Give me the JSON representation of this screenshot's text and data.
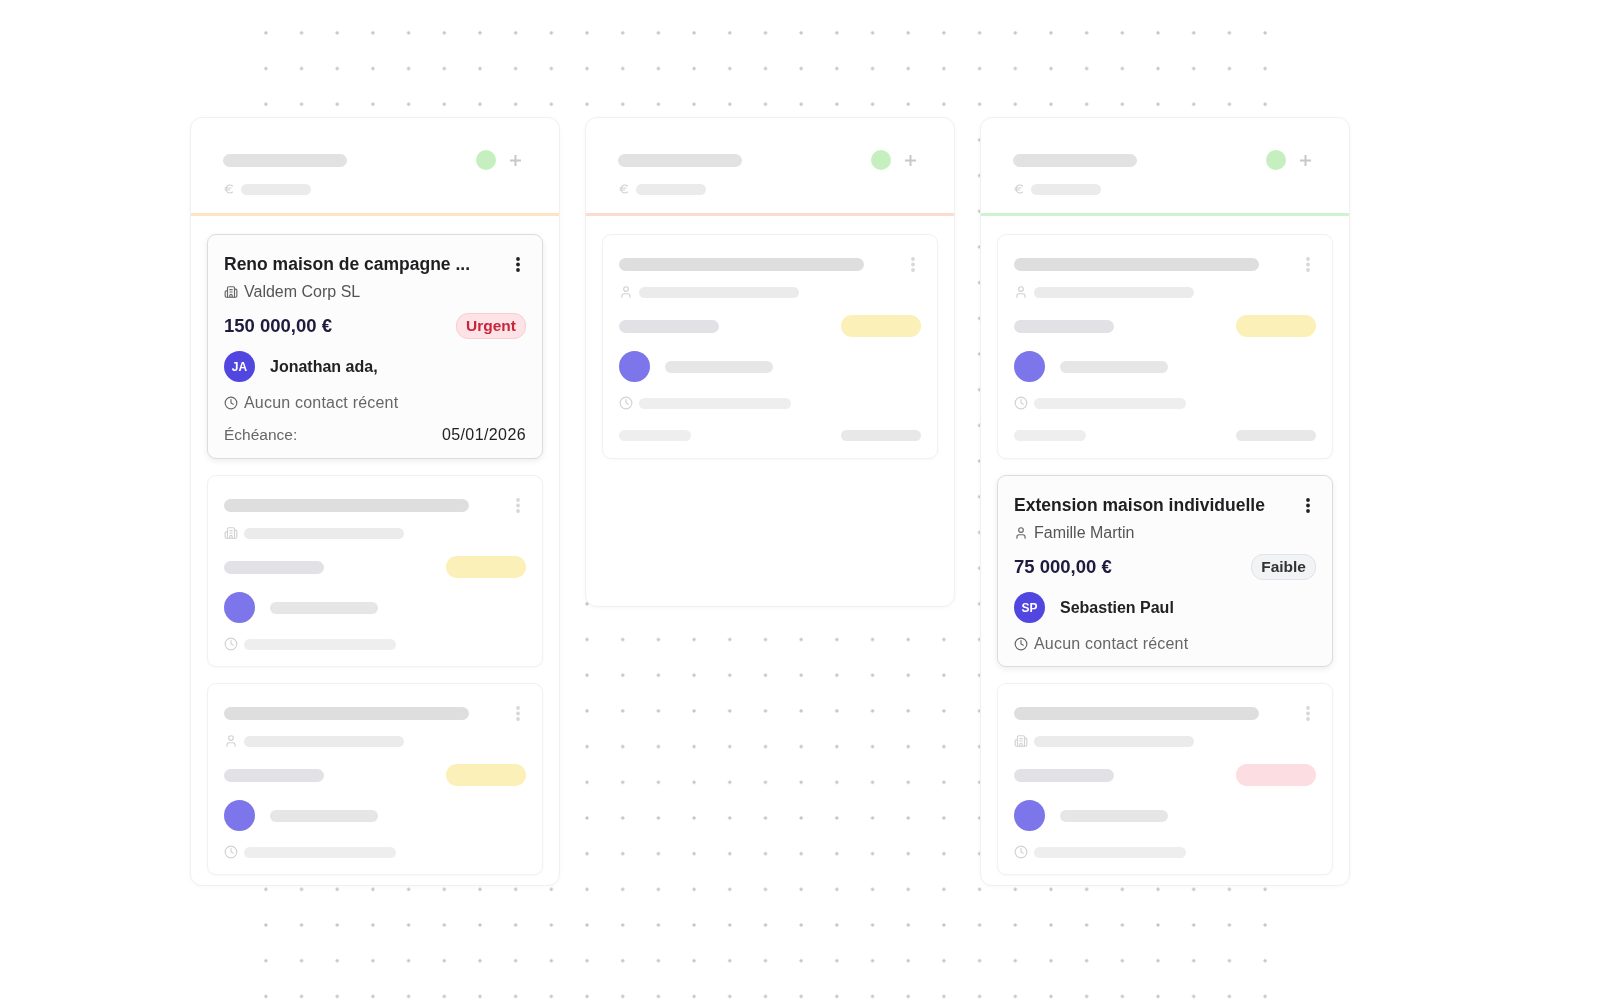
{
  "columns": [
    {
      "color": "#fde4c4",
      "cards": [
        {
          "blurred": false,
          "title": "Reno maison de campagne ...",
          "client": {
            "kind": "company",
            "name": "Valdem Corp SL"
          },
          "amount": "150 000,00 €",
          "priority": {
            "kind": "urgent",
            "label": "Urgent"
          },
          "assignee": {
            "initials": "JA",
            "name": "Jonathan ada,"
          },
          "last_contact": "Aucun contact récent",
          "due": {
            "label": "Échéance:",
            "date": "05/01/2026"
          }
        },
        {
          "blurred": true,
          "client": {
            "kind": "company"
          },
          "priority": {
            "kind": "medium"
          },
          "has_due": false
        },
        {
          "blurred": true,
          "client": {
            "kind": "person"
          },
          "priority": {
            "kind": "medium"
          },
          "has_due": false
        }
      ]
    },
    {
      "color": "#fcdccf",
      "cards": [
        {
          "blurred": true,
          "client": {
            "kind": "person"
          },
          "priority": {
            "kind": "medium"
          },
          "has_due": true
        }
      ]
    },
    {
      "color": "#cdf3d3",
      "cards": [
        {
          "blurred": true,
          "client": {
            "kind": "person"
          },
          "priority": {
            "kind": "medium"
          },
          "has_due": true
        },
        {
          "blurred": false,
          "title": "Extension maison individuelle",
          "client": {
            "kind": "person",
            "name": "Famille Martin"
          },
          "amount": "75 000,00 €",
          "priority": {
            "kind": "low",
            "label": "Faible"
          },
          "assignee": {
            "initials": "SP",
            "name": "Sebastien Paul"
          },
          "last_contact": "Aucun contact récent"
        },
        {
          "blurred": true,
          "client": {
            "kind": "company"
          },
          "priority": {
            "kind": "urgent"
          },
          "has_due": false
        }
      ]
    }
  ]
}
